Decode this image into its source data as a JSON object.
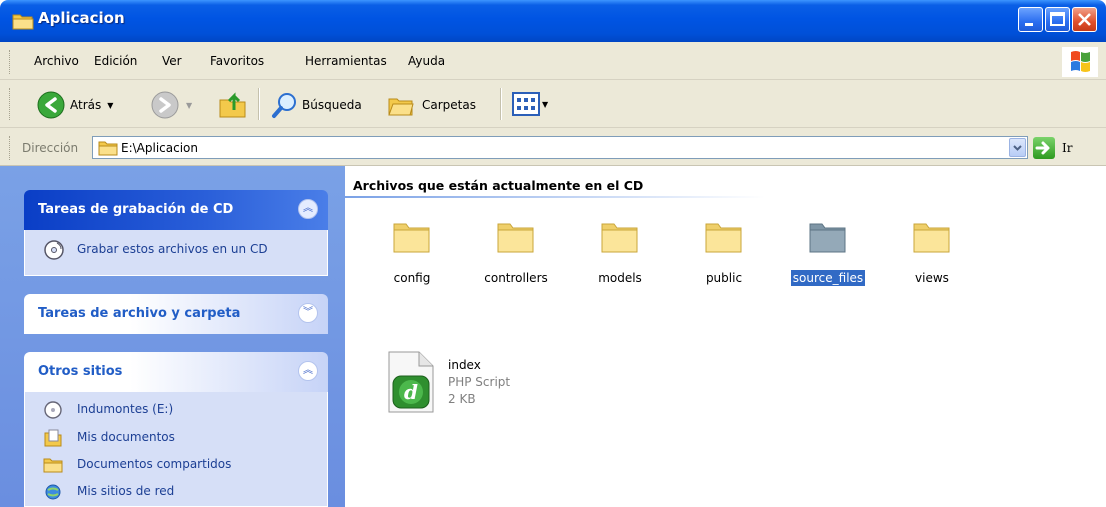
{
  "window": {
    "title": "Aplicacion"
  },
  "menubar": {
    "items": [
      "Archivo",
      "Edición",
      "Ver",
      "Favoritos",
      "Herramientas",
      "Ayuda"
    ]
  },
  "toolbar": {
    "back_label": "Atrás",
    "search_label": "Búsqueda",
    "folders_label": "Carpetas"
  },
  "address": {
    "label": "Dirección",
    "value": "E:\\Aplicacion",
    "go_label": "Ir"
  },
  "taskpane": {
    "cd_tasks": {
      "title": "Tareas de grabación de CD",
      "items": [
        "Grabar estos archivos en un CD"
      ]
    },
    "file_tasks": {
      "title": "Tareas de archivo y carpeta"
    },
    "other_places": {
      "title": "Otros sitios",
      "items": [
        "Indumontes (E:)",
        "Mis documentos",
        "Documentos compartidos",
        "Mis sitios de red"
      ]
    }
  },
  "content": {
    "group_header": "Archivos que están actualmente en el CD",
    "folders": [
      "config",
      "controllers",
      "models",
      "public",
      "source_files",
      "views"
    ],
    "selected_folder": "source_files",
    "file": {
      "name": "index",
      "type": "PHP Script",
      "size": "2 KB"
    }
  },
  "colors": {
    "titlebar": "#0054e3",
    "taskpane": "#7aa1e6",
    "selection": "#316ac5",
    "folder": "#f5d97a"
  }
}
